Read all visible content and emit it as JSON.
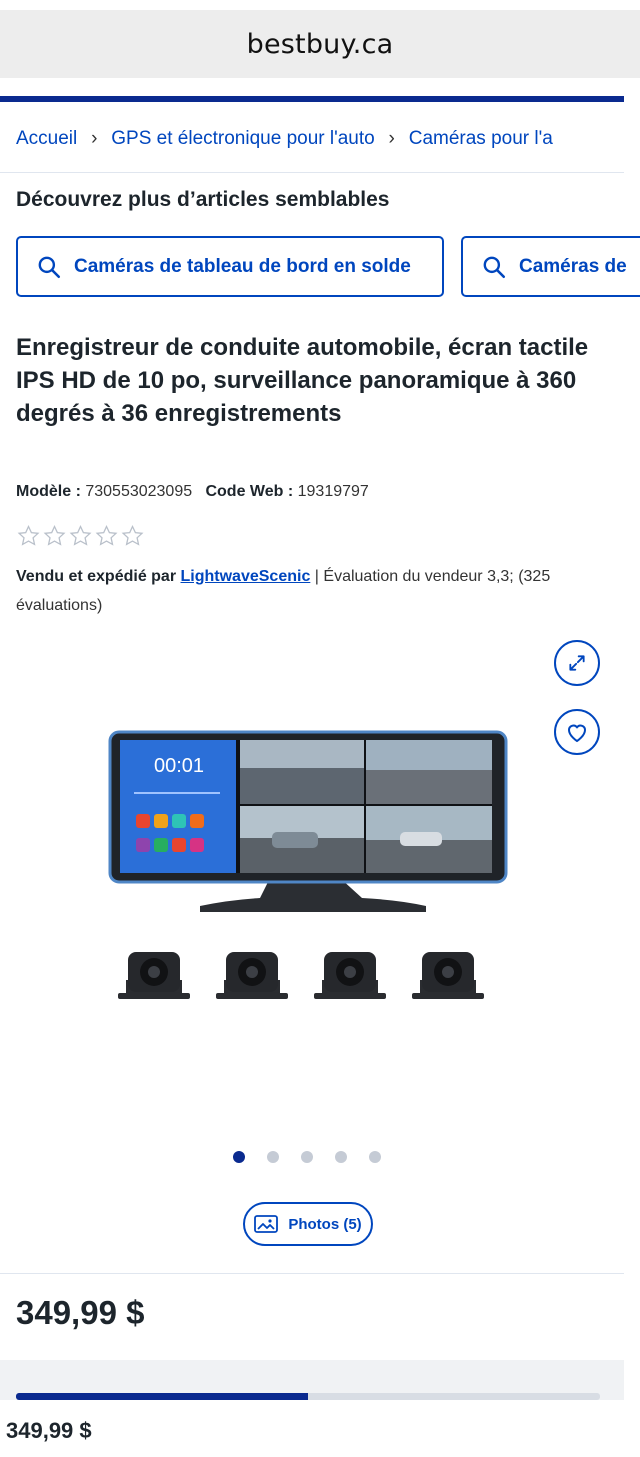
{
  "browser": {
    "url": "bestbuy.ca"
  },
  "breadcrumb": {
    "items": [
      "Accueil",
      "GPS et électronique pour l'auto",
      "Caméras pour l'a"
    ]
  },
  "similar": {
    "title": "Découvrez plus d’articles semblables",
    "chips": [
      "Caméras de tableau de bord en solde",
      "Caméras de"
    ]
  },
  "product": {
    "title": "Enregistreur de conduite automobile, écran tactile IPS HD de 10 po, surveillance panoramique à 360 degrés à 36 enregistrements",
    "model_label": "Modèle :",
    "model_value": "730553023095",
    "web_code_label": "Code Web :",
    "web_code_value": "19319797",
    "rating_stars": 0,
    "seller_prefix": "Vendu et expédié par",
    "seller_name": "LightwaveScenic",
    "seller_suffix": " | Évaluation du vendeur 3,3; (325 évaluations)",
    "screen_time": "00:01",
    "photos_label": "Photos (5)",
    "carousel_count": 5,
    "carousel_active": 0,
    "price": "349,99 $"
  },
  "purchase_bar": {
    "progress": 0.5,
    "price": "349,99 $"
  },
  "colors": {
    "accent": "#0046be",
    "brand_navy": "#0a2a8f",
    "text": "#1d252c"
  },
  "icons": {
    "chip": "search-icon",
    "expand": "expand-icon",
    "wishlist": "heart-icon",
    "photos": "image-icon",
    "rating": "star-icon"
  }
}
